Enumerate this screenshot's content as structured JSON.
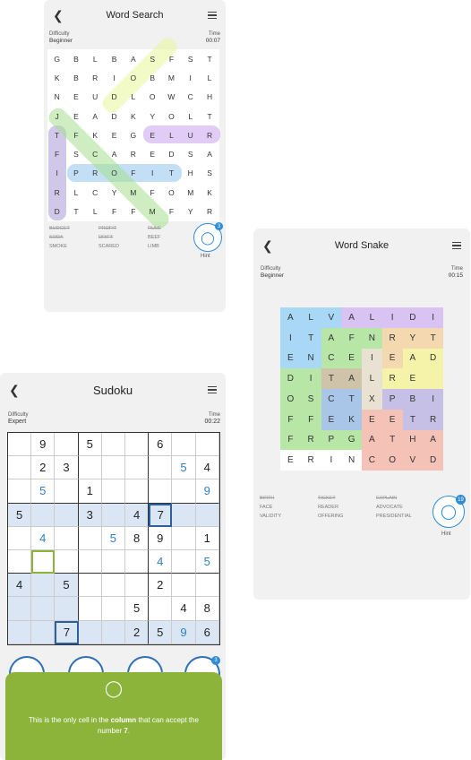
{
  "word_search": {
    "title": "Word Search",
    "difficulty_label": "Difficulty",
    "difficulty": "Beginner",
    "time_label": "Time",
    "time": "00:07",
    "grid": [
      [
        "G",
        "B",
        "L",
        "B",
        "A",
        "S",
        "F",
        "S",
        "T"
      ],
      [
        "K",
        "B",
        "R",
        "I",
        "O",
        "B",
        "M",
        "I",
        "L"
      ],
      [
        "N",
        "E",
        "U",
        "D",
        "L",
        "O",
        "W",
        "C",
        "H"
      ],
      [
        "J",
        "E",
        "A",
        "D",
        "K",
        "Y",
        "O",
        "L",
        "T"
      ],
      [
        "T",
        "F",
        "K",
        "E",
        "G",
        "E",
        "L",
        "U",
        "R"
      ],
      [
        "F",
        "S",
        "C",
        "A",
        "R",
        "E",
        "D",
        "S",
        "A"
      ],
      [
        "I",
        "P",
        "R",
        "O",
        "F",
        "I",
        "T",
        "H",
        "S"
      ],
      [
        "R",
        "L",
        "C",
        "Y",
        "M",
        "F",
        "O",
        "M",
        "K"
      ],
      [
        "D",
        "T",
        "L",
        "F",
        "F",
        "M",
        "F",
        "Y",
        "R"
      ]
    ],
    "words": [
      {
        "text": "BUDGET",
        "found": true
      },
      {
        "text": "PROFIT",
        "found": true
      },
      {
        "text": "RULE",
        "found": true
      },
      {
        "text": "SODA",
        "found": true
      },
      {
        "text": "DRIFT",
        "found": true
      },
      {
        "text": "BEEF",
        "found": false
      },
      {
        "text": "SMOKE",
        "found": false
      },
      {
        "text": "SCARED",
        "found": false
      },
      {
        "text": "LIMB",
        "found": false
      }
    ],
    "hint_label": "Hint",
    "hint_count": "3"
  },
  "word_snake": {
    "title": "Word Snake",
    "difficulty_label": "Difficulty",
    "difficulty": "Beginner",
    "time_label": "Time",
    "time": "00:15",
    "grid": [
      [
        "A",
        "L",
        "V",
        "A",
        "L",
        "I",
        "D",
        "I"
      ],
      [
        "I",
        "T",
        "A",
        "F",
        "N",
        "R",
        "Y",
        "T"
      ],
      [
        "E",
        "N",
        "C",
        "E",
        "I",
        "E",
        "A",
        "D"
      ],
      [
        "D",
        "I",
        "T",
        "A",
        "L",
        "R",
        "E",
        ""
      ],
      [
        "O",
        "S",
        "C",
        "T",
        "X",
        "P",
        "B",
        "I"
      ],
      [
        "F",
        "F",
        "E",
        "K",
        "E",
        "E",
        "T",
        "R"
      ],
      [
        "F",
        "R",
        "P",
        "G",
        "A",
        "T",
        "H",
        "A"
      ],
      [
        "E",
        "R",
        "I",
        "N",
        "C",
        "O",
        "V",
        "D"
      ]
    ],
    "words": [
      {
        "text": "BIRTH",
        "found": true
      },
      {
        "text": "TICKET",
        "found": true
      },
      {
        "text": "EXPLAIN",
        "found": true
      },
      {
        "text": "FACE",
        "found": false
      },
      {
        "text": "READER",
        "found": false
      },
      {
        "text": "ADVOCATE",
        "found": false
      },
      {
        "text": "VALIDITY",
        "found": false
      },
      {
        "text": "OFFERING",
        "found": false
      },
      {
        "text": "PRESIDENTIAL",
        "found": false
      }
    ],
    "hint_label": "Hint",
    "hint_count": "19"
  },
  "sudoku": {
    "title": "Sudoku",
    "difficulty_label": "Difficulty",
    "difficulty": "Expert",
    "time_label": "Time",
    "time": "00:22",
    "grid": [
      [
        "",
        "9",
        "",
        "5",
        "",
        "",
        "6",
        "",
        ""
      ],
      [
        "",
        "2",
        "3",
        "",
        "",
        "",
        "",
        "5",
        "4"
      ],
      [
        "",
        "5",
        "",
        "1",
        "",
        "",
        "",
        "",
        "9"
      ],
      [
        "5",
        "",
        "",
        "3",
        "",
        "4",
        "7",
        "",
        ""
      ],
      [
        "",
        "4",
        "",
        "",
        "5",
        "8",
        "9",
        "",
        "1"
      ],
      [
        "",
        "",
        "",
        "",
        "",
        "",
        "4",
        "",
        "5"
      ],
      [
        "4",
        "",
        "5",
        "",
        "",
        "",
        "2",
        "",
        ""
      ],
      [
        "",
        "",
        "",
        "",
        "",
        "5",
        "",
        "4",
        "8"
      ],
      [
        "",
        "",
        "7",
        "",
        "",
        "2",
        "5",
        "9",
        "6"
      ]
    ],
    "tip_text_before": "This is the only cell in the ",
    "tip_text_bold": "column",
    "tip_text_mid": " that can accept the number ",
    "tip_number": "7",
    "tip_text_end": ".",
    "hint_count": "3"
  }
}
